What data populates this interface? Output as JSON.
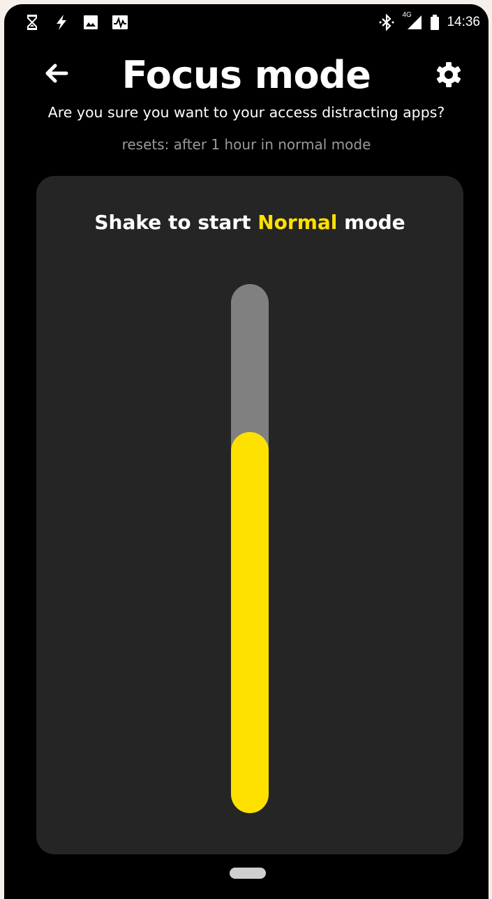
{
  "status_bar": {
    "time": "14:36",
    "network_label": "4G",
    "left_icons": [
      "hourglass-icon",
      "flash-icon",
      "image-icon",
      "activity-icon"
    ],
    "right_icons": [
      "bluetooth-icon",
      "signal-icon",
      "battery-icon"
    ]
  },
  "header": {
    "title": "Focus mode",
    "back_icon": "arrow-left-icon",
    "settings_icon": "gear-icon"
  },
  "prompt": "Are you sure you want to your access distracting apps?",
  "reset_note": "resets: after 1 hour in normal mode",
  "card": {
    "heading_prefix": "Shake to start ",
    "heading_accent": "Normal",
    "heading_suffix": " mode",
    "shake_progress": 0.72
  },
  "colors": {
    "accent": "#ffe100",
    "background": "#000000",
    "card": "#252525",
    "track": "#808080"
  }
}
